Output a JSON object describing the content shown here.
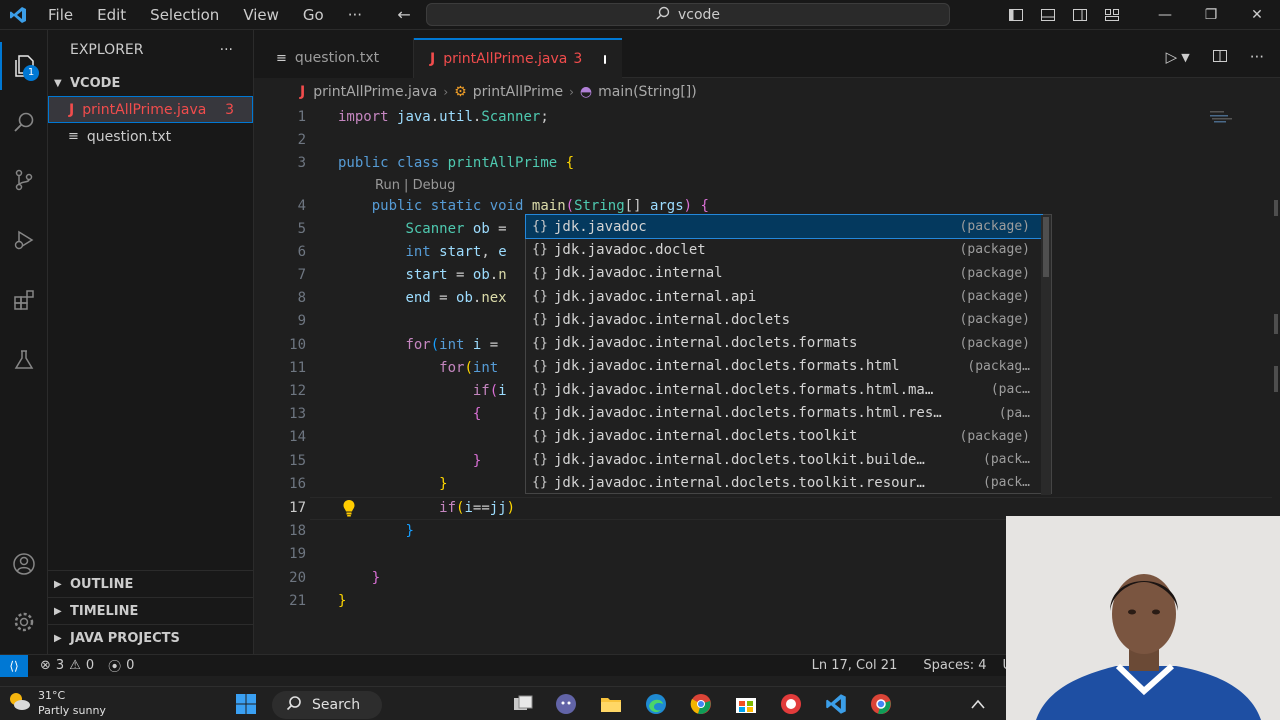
{
  "titlebar": {
    "menu": [
      "File",
      "Edit",
      "Selection",
      "View",
      "Go"
    ],
    "more": "···",
    "search_text": "vcode"
  },
  "activity": {
    "explorer_badge": "1"
  },
  "sidebar": {
    "title": "EXPLORER",
    "more": "···",
    "folder": "VCODE",
    "files": [
      {
        "name": "printAllPrime.java",
        "icon": "java-icon",
        "errors": "3"
      },
      {
        "name": "question.txt",
        "icon": "text-file-icon",
        "errors": ""
      }
    ],
    "sections": [
      "OUTLINE",
      "TIMELINE",
      "JAVA PROJECTS"
    ]
  },
  "tabs": [
    {
      "label": "question.txt",
      "active": false
    },
    {
      "label": "printAllPrime.java",
      "problems": "3",
      "active": true
    }
  ],
  "breadcrumb": {
    "file": "printAllPrime.java",
    "class": "printAllPrime",
    "method": "main(String[])"
  },
  "editor": {
    "codelens": "Run | Debug",
    "line_numbers": [
      "1",
      "2",
      "3",
      "4",
      "5",
      "6",
      "7",
      "8",
      "9",
      "10",
      "11",
      "12",
      "13",
      "14",
      "15",
      "16",
      "17",
      "18",
      "19",
      "20",
      "21"
    ],
    "current_line": "17"
  },
  "suggest": {
    "items": [
      {
        "label": "jdk.javadoc",
        "detail": "(package)"
      },
      {
        "label": "jdk.javadoc.doclet",
        "detail": "(package)"
      },
      {
        "label": "jdk.javadoc.internal",
        "detail": "(package)"
      },
      {
        "label": "jdk.javadoc.internal.api",
        "detail": "(package)"
      },
      {
        "label": "jdk.javadoc.internal.doclets",
        "detail": "(package)"
      },
      {
        "label": "jdk.javadoc.internal.doclets.formats",
        "detail": "(package)"
      },
      {
        "label": "jdk.javadoc.internal.doclets.formats.html",
        "detail": "(packag…"
      },
      {
        "label": "jdk.javadoc.internal.doclets.formats.html.ma…",
        "detail": "(pac…"
      },
      {
        "label": "jdk.javadoc.internal.doclets.formats.html.res…",
        "detail": "(pa…"
      },
      {
        "label": "jdk.javadoc.internal.doclets.toolkit",
        "detail": "(package)"
      },
      {
        "label": "jdk.javadoc.internal.doclets.toolkit.builde…",
        "detail": "(pack…"
      },
      {
        "label": "jdk.javadoc.internal.doclets.toolkit.resour…",
        "detail": "(pack…"
      }
    ]
  },
  "statusbar": {
    "errors": "3",
    "warnings": "0",
    "ports": "0",
    "position": "Ln 17, Col 21",
    "spaces": "Spaces: 4",
    "encoding": "UT"
  },
  "taskbar": {
    "temperature": "31°C",
    "condition": "Partly sunny",
    "search_label": "Search"
  },
  "colors": {
    "accent": "#0078d4",
    "error": "#f14c4c",
    "keyword": "#569cd6",
    "type": "#4ec9b0",
    "function": "#dcdcaa",
    "variable": "#9cdcfe"
  }
}
